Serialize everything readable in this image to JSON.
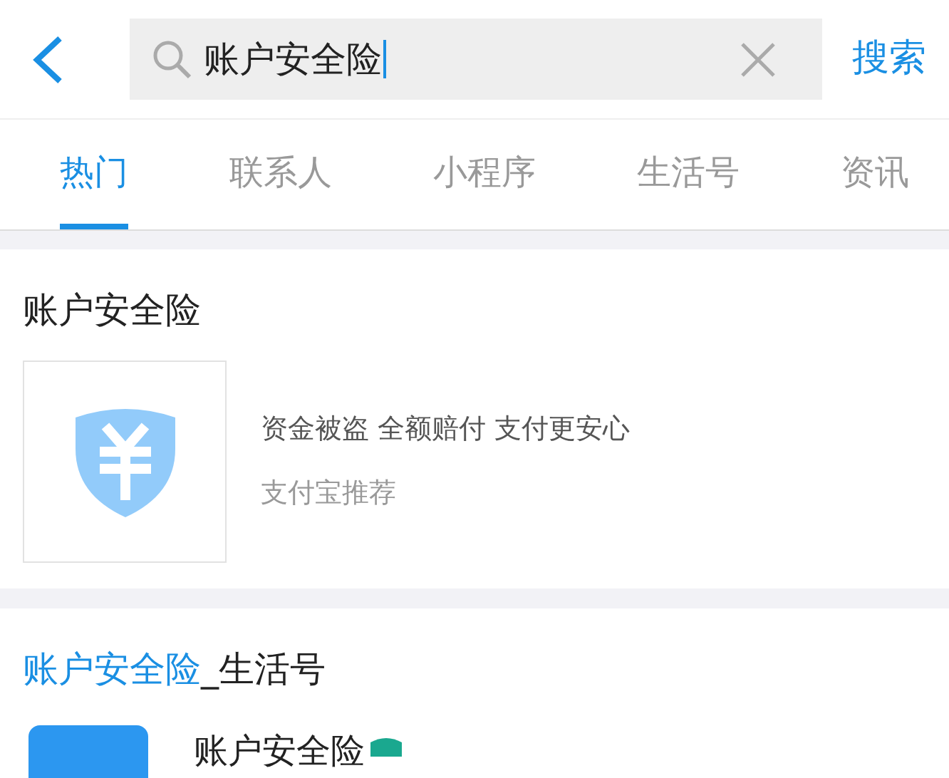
{
  "search": {
    "value": "账户安全险",
    "action": "搜索"
  },
  "tabs": [
    {
      "label": "热门",
      "selected": true
    },
    {
      "label": "联系人",
      "selected": false
    },
    {
      "label": "小程序",
      "selected": false
    },
    {
      "label": "生活号",
      "selected": false
    },
    {
      "label": "资讯",
      "selected": false
    }
  ],
  "result": {
    "title": "账户安全险",
    "description": "资金被盗 全额赔付 支付更安心",
    "source": "支付宝推荐"
  },
  "section": {
    "highlight": "账户安全险",
    "rest": "_生活号",
    "items": [
      {
        "name": "账户安全险"
      }
    ]
  }
}
